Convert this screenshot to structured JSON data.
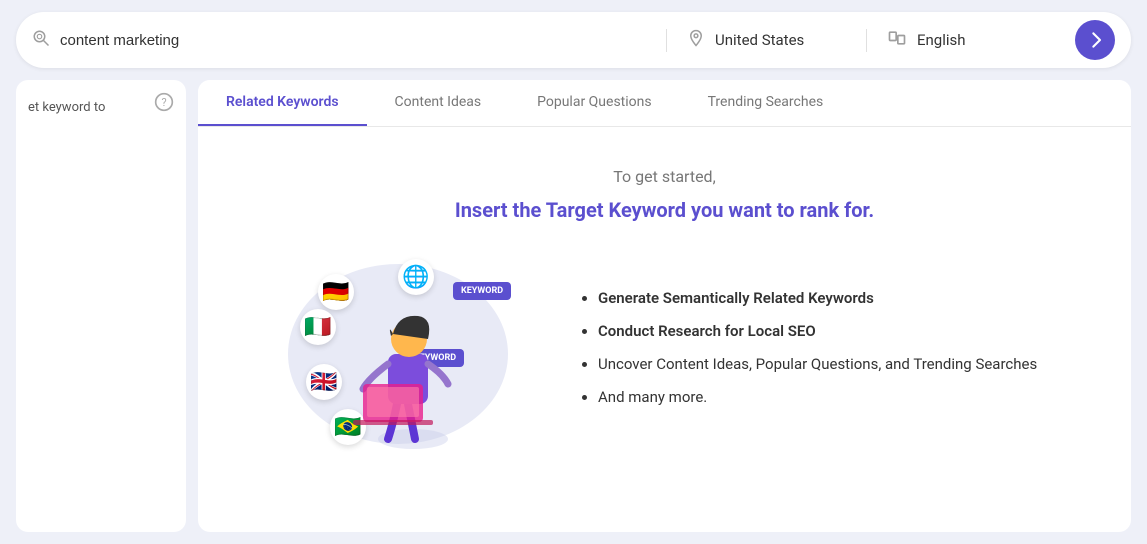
{
  "topbar": {
    "search_placeholder": "content marketing",
    "search_value": "content marketing",
    "location_label": "United States",
    "language_label": "English",
    "submit_label": "Go"
  },
  "tabs": [
    {
      "id": "related-keywords",
      "label": "Related Keywords",
      "active": true
    },
    {
      "id": "content-ideas",
      "label": "Content Ideas",
      "active": false
    },
    {
      "id": "popular-questions",
      "label": "Popular Questions",
      "active": false
    },
    {
      "id": "trending-searches",
      "label": "Trending Searches",
      "active": false
    }
  ],
  "sidebar": {
    "helper_text": "et keyword to"
  },
  "main": {
    "intro_text": "To get started,",
    "heading": "Insert the Target Keyword you want to rank for.",
    "features": [
      "Generate Semantically Related Keywords",
      "Conduct Research for Local SEO",
      "Uncover Content Ideas, Popular Questions, and Trending Searches",
      "And many more."
    ],
    "features_bold": [
      0,
      1,
      2,
      3
    ]
  },
  "icons": {
    "search": "⊙",
    "location": "📍",
    "language": "🔤",
    "arrow_right": "→",
    "help": "?",
    "flags": [
      "🇩🇪",
      "🌐",
      "🇮🇹",
      "🇬🇧",
      "🇧🇷"
    ]
  }
}
